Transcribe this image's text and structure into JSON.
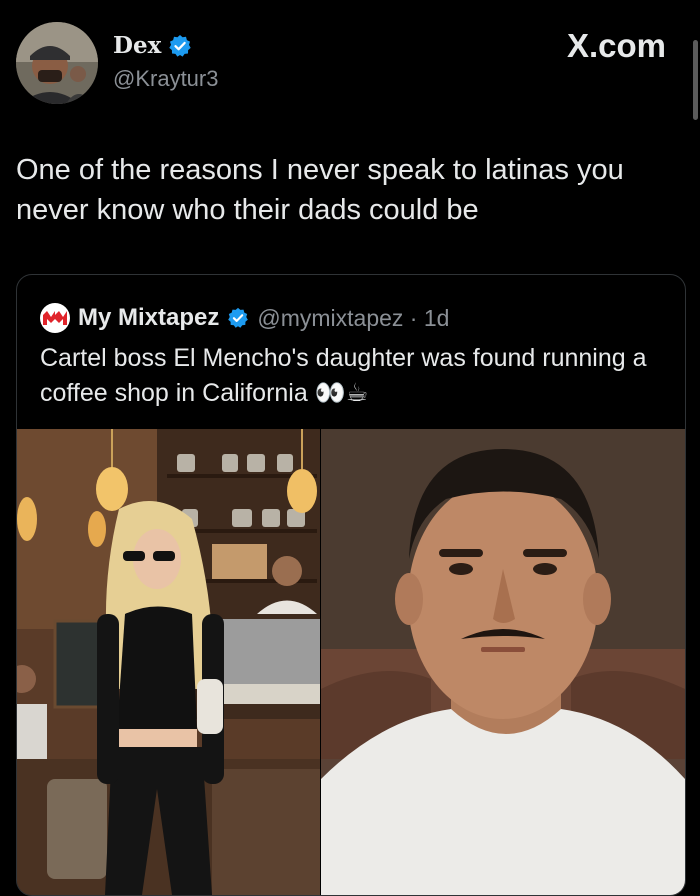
{
  "author": {
    "name": "Dex",
    "handle": "@Kraytur3",
    "verified": true,
    "avatar_icon": "man-with-cap-avatar"
  },
  "site_label": "X.com",
  "tweet": {
    "text": "One of the reasons I never speak to latinas you never know who their dads could be"
  },
  "quoted": {
    "account_name": "My Mixtapez",
    "handle_time": "@mymixtapez · 1d",
    "verified": true,
    "logo_icon": "mymixtapez-logo",
    "text": "Cartel boss El Mencho's daughter was found running a coffee shop in California 👀☕",
    "media": [
      {
        "description_icon": "woman-in-coffee-shop-photo"
      },
      {
        "description_icon": "man-mugshot-photo"
      }
    ]
  },
  "colors": {
    "background": "#000000",
    "text": "#e7e9ea",
    "secondary": "#8b9096",
    "verified_blue": "#1d9bf0",
    "border": "#2f3336",
    "brand_red": "#e0242b"
  }
}
